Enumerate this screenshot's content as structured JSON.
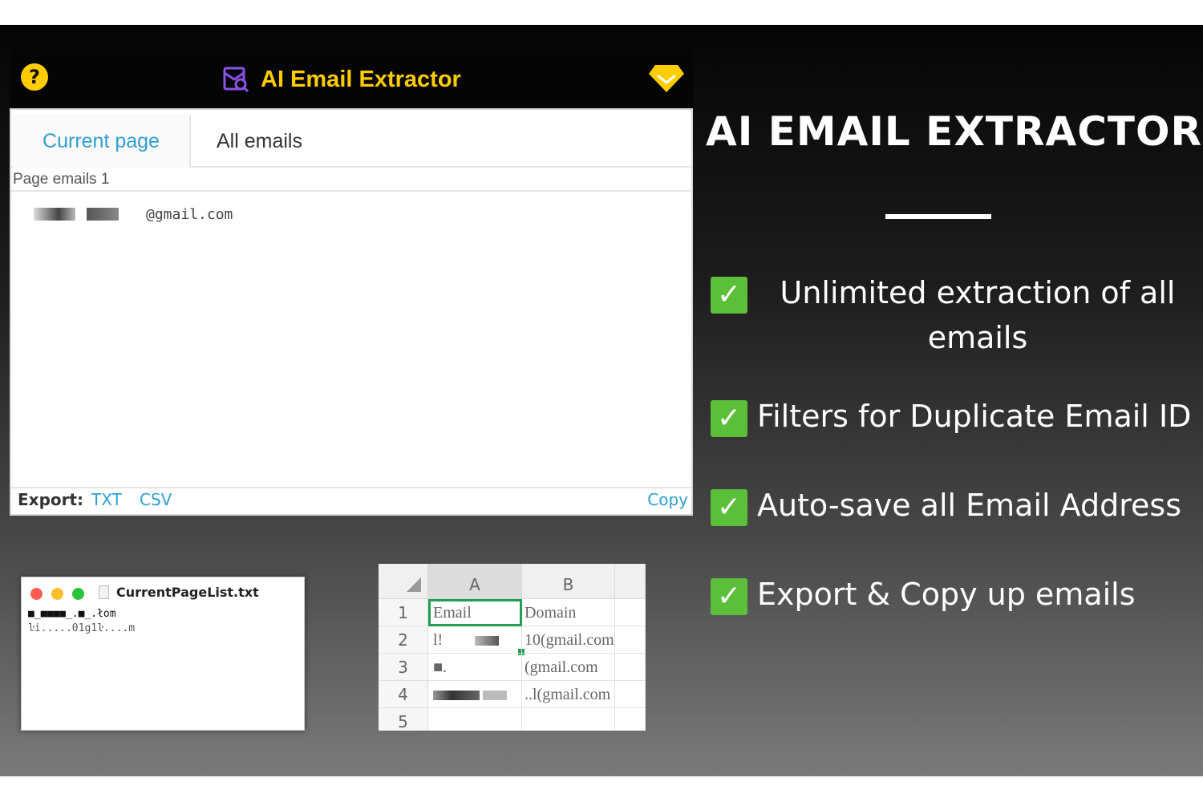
{
  "popup": {
    "title": "AI Email Extractor",
    "tabs": [
      {
        "label": "Current page"
      },
      {
        "label": "All emails"
      }
    ],
    "page_emails_label": "Page emails 1",
    "emails": [
      {
        "domain": "@gmail.com"
      }
    ],
    "footer": {
      "export_label": "Export:",
      "txt_label": "TXT",
      "csv_label": "CSV",
      "copy_label": "Copy"
    },
    "colors": {
      "accent_yellow": "#ffcc00",
      "link_blue": "#2f9fd4"
    }
  },
  "text_window": {
    "filename": "CurrentPageList.txt",
    "line1": "■_■■■■_.■_.łom",
    "line2": "ŀi.....01g1ŀ....m"
  },
  "spreadsheet": {
    "columns": [
      "A",
      "B"
    ],
    "rows": [
      {
        "num": "1",
        "a": "Email",
        "b": "Domain"
      },
      {
        "num": "2",
        "a": "l!",
        "b": "10(gmail.com"
      },
      {
        "num": "3",
        "a": "■.",
        "b": "(gmail.com"
      },
      {
        "num": "4",
        "a": "",
        "b": "..l(gmail.com"
      },
      {
        "num": "5",
        "a": "",
        "b": ""
      }
    ]
  },
  "promo": {
    "title": "AI EMAIL EXTRACTOR",
    "features": [
      {
        "line1": "Unlimited extraction of all",
        "line2": "emails"
      },
      {
        "line1": "Filters for Duplicate Email ID"
      },
      {
        "line1": "Auto-save all Email Address"
      },
      {
        "line1": "Export & Copy up emails"
      }
    ],
    "check_color": "#5cbf3a"
  }
}
